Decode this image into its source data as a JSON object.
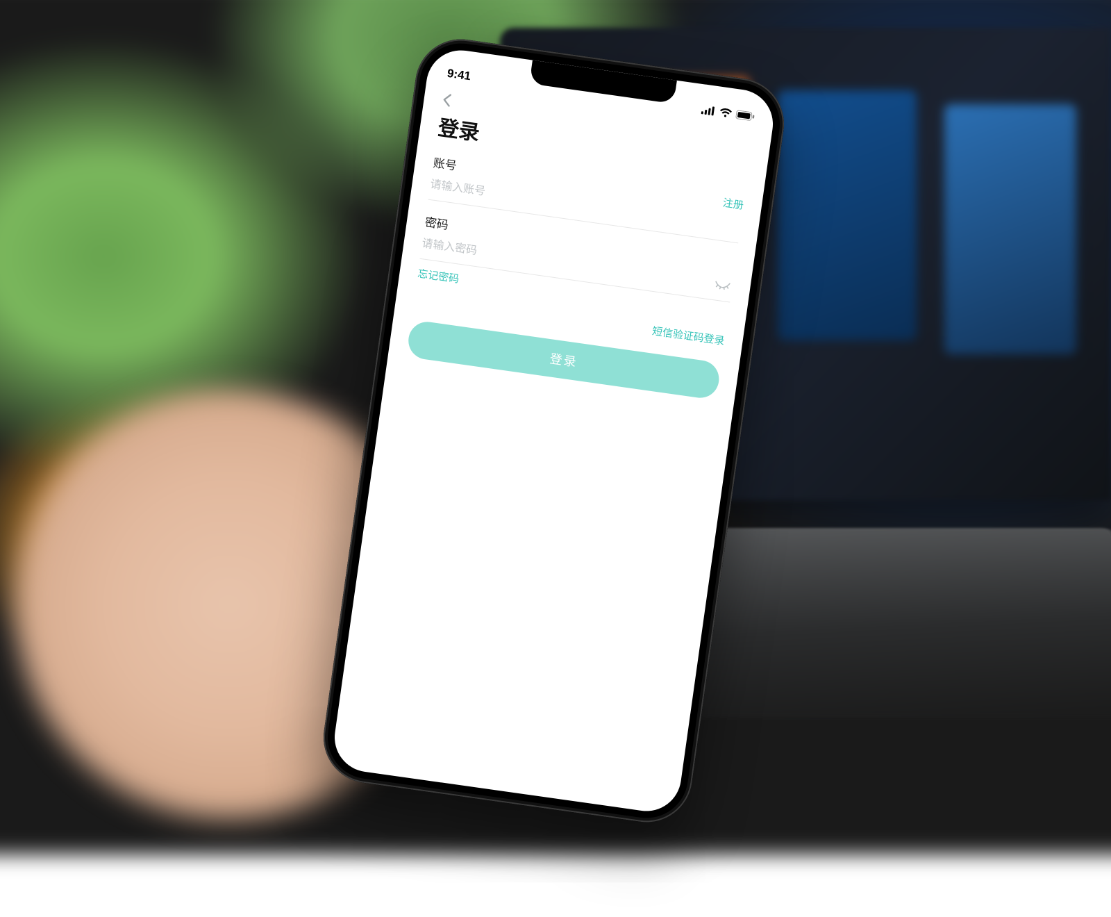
{
  "statusbar": {
    "time": "9:41"
  },
  "page": {
    "title": "登录",
    "account_label": "账号",
    "account_placeholder": "请输入账号",
    "password_label": "密码",
    "password_placeholder": "请输入密码",
    "register_link": "注册",
    "forgot_link": "忘记密码",
    "sms_login_link": "短信验证码登录",
    "login_button": "登录"
  },
  "colors": {
    "accent": "#35c3b8",
    "button": "#8fe0d5"
  }
}
